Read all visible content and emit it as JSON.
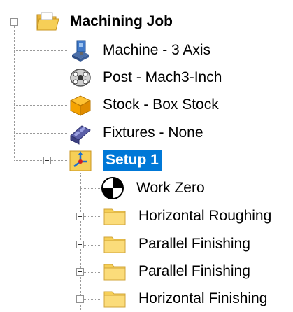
{
  "tree": {
    "root": {
      "label": "Machining Job",
      "icon": "folder-open-icon",
      "expanded": true
    },
    "items": [
      {
        "label": "Machine - 3 Axis",
        "icon": "machine-icon"
      },
      {
        "label": "Post - Mach3-Inch",
        "icon": "post-icon"
      },
      {
        "label": "Stock - Box Stock",
        "icon": "stock-box-icon"
      },
      {
        "label": "Fixtures - None",
        "icon": "fixtures-icon"
      }
    ],
    "setup": {
      "label": "Setup 1",
      "icon": "setup-icon",
      "expanded": true,
      "selected": true,
      "children": [
        {
          "label": "Work Zero",
          "icon": "work-zero-icon",
          "expandable": false
        },
        {
          "label": "Horizontal Roughing",
          "icon": "folder-icon",
          "expandable": true
        },
        {
          "label": "Parallel Finishing",
          "icon": "folder-icon",
          "expandable": true
        },
        {
          "label": "Parallel Finishing",
          "icon": "folder-icon",
          "expandable": true
        },
        {
          "label": "Horizontal Finishing",
          "icon": "folder-icon",
          "expandable": true
        }
      ]
    }
  },
  "colors": {
    "selection": "#0078d7",
    "folder": "#f6cf57",
    "stock": "#f5a300"
  }
}
